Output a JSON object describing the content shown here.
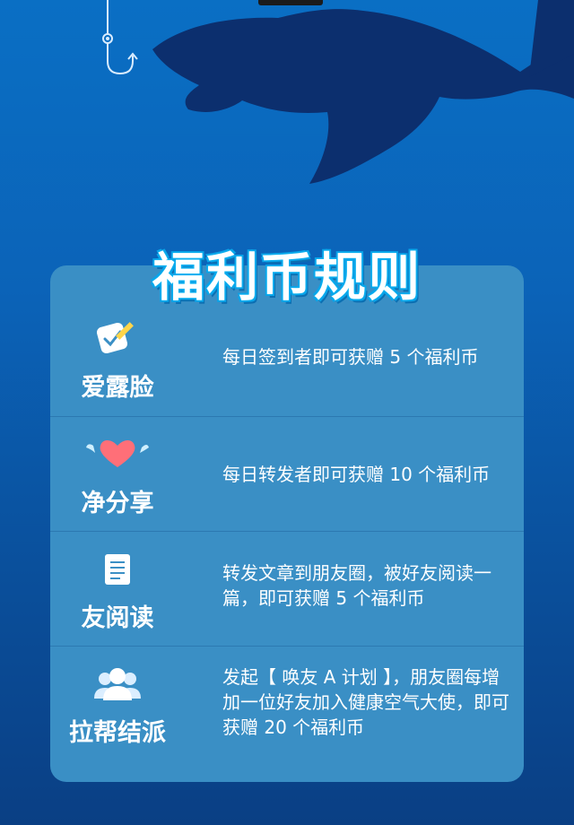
{
  "title": "福利币规则",
  "rules": [
    {
      "label": "爱露脸",
      "icon": "checkin-pencil-icon",
      "desc": "每日签到者即可获赠 5 个福利币"
    },
    {
      "label": "净分享",
      "icon": "winged-heart-icon",
      "desc": "每日转发者即可获赠 10 个福利币"
    },
    {
      "label": "友阅读",
      "icon": "document-icon",
      "desc": "转发文章到朋友圈，被好友阅读一篇，即可获赠 5 个福利币"
    },
    {
      "label": "拉帮结派",
      "icon": "group-users-icon",
      "desc": "发起【 唤友 A 计划 】，朋友圈每增加一位好友加入健康空气大使，即可获赠 20 个福利币"
    }
  ],
  "colors": {
    "card": "#3a8fc5",
    "background_top": "#0a6fc4",
    "background_bottom": "#0a3f84",
    "shark": "#0c2f6e",
    "title_outline": "#0aa2e8"
  }
}
